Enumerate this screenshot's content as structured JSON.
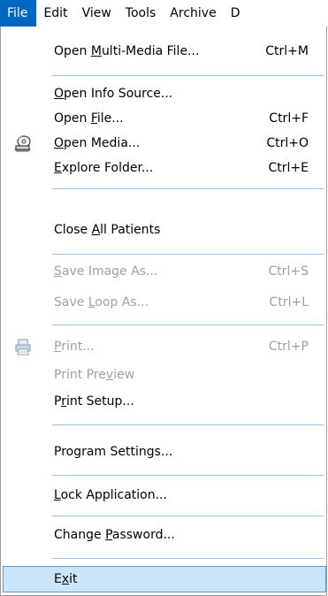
{
  "menubar": {
    "items": [
      "File",
      "Edit",
      "View",
      "Tools",
      "Archive",
      "D"
    ]
  },
  "menu": {
    "items": [
      {
        "pre": "Open ",
        "key": "M",
        "post": "ulti-Media File...",
        "shortcut": "Ctrl+M"
      },
      {
        "pre": "",
        "key": "O",
        "post": "pen Info Source...",
        "shortcut": ""
      },
      {
        "pre": "Open ",
        "key": "F",
        "post": "ile...",
        "shortcut": "Ctrl+F"
      },
      {
        "pre": "",
        "key": "O",
        "post": "pen Media...",
        "shortcut": "Ctrl+O",
        "icon": "cd-media-icon"
      },
      {
        "pre": "",
        "key": "E",
        "post": "xplore Folder...",
        "shortcut": "Ctrl+E"
      },
      {
        "pre": "Close ",
        "key": "A",
        "post": "ll Patients",
        "shortcut": ""
      },
      {
        "pre": "",
        "key": "S",
        "post": "ave Image As...",
        "shortcut": "Ctrl+S"
      },
      {
        "pre": "Save ",
        "key": "L",
        "post": "oop As...",
        "shortcut": "Ctrl+L"
      },
      {
        "pre": "",
        "key": "P",
        "post": "rint...",
        "shortcut": "Ctrl+P",
        "icon": "printer-icon"
      },
      {
        "pre": "Print Pre",
        "key": "v",
        "post": "iew",
        "shortcut": ""
      },
      {
        "pre": "P",
        "key": "r",
        "post": "int Setup...",
        "shortcut": ""
      },
      {
        "pre": "Program Settings...",
        "key": "",
        "post": "",
        "shortcut": ""
      },
      {
        "pre": "",
        "key": "L",
        "post": "ock Application...",
        "shortcut": ""
      },
      {
        "pre": "Change ",
        "key": "P",
        "post": "assword...",
        "shortcut": ""
      },
      {
        "pre": "E",
        "key": "x",
        "post": "it",
        "shortcut": ""
      }
    ]
  }
}
